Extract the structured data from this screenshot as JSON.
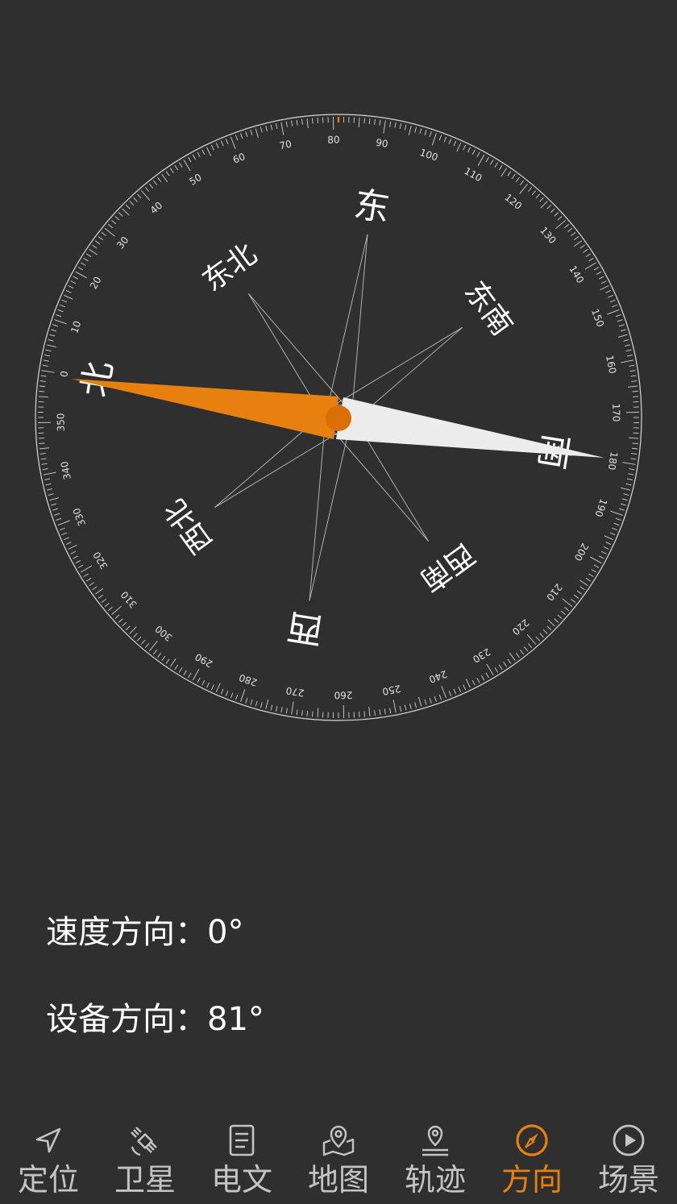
{
  "compass": {
    "device_heading_deg": 81,
    "ticks_major": [
      "0",
      "10",
      "20",
      "30",
      "40",
      "50",
      "60",
      "70",
      "80",
      "90",
      "100",
      "110",
      "120",
      "130",
      "140",
      "150",
      "160",
      "170",
      "180",
      "190",
      "200",
      "210",
      "220",
      "230",
      "240",
      "250",
      "260",
      "270",
      "280",
      "290",
      "300",
      "310",
      "320",
      "330",
      "340",
      "350"
    ],
    "directions": {
      "north": "北",
      "northeast": "东北",
      "east": "东",
      "southeast": "东南",
      "south": "南",
      "southwest": "西南",
      "west": "西",
      "northwest": "西北"
    },
    "colors": {
      "accent": "#e8800f",
      "needle_south": "#ececec",
      "line": "#bdbdbd"
    }
  },
  "info": {
    "speed_label": "速度方向：0°",
    "device_label": "设备方向：81°"
  },
  "nav": {
    "items": [
      {
        "label": "定位",
        "icon": "location-arrow-icon",
        "active": false
      },
      {
        "label": "卫星",
        "icon": "satellite-icon",
        "active": false
      },
      {
        "label": "电文",
        "icon": "document-icon",
        "active": false
      },
      {
        "label": "地图",
        "icon": "map-pin-icon",
        "active": false
      },
      {
        "label": "轨迹",
        "icon": "track-pin-icon",
        "active": false
      },
      {
        "label": "方向",
        "icon": "compass-icon",
        "active": true
      },
      {
        "label": "场景",
        "icon": "play-icon",
        "active": false
      }
    ]
  }
}
